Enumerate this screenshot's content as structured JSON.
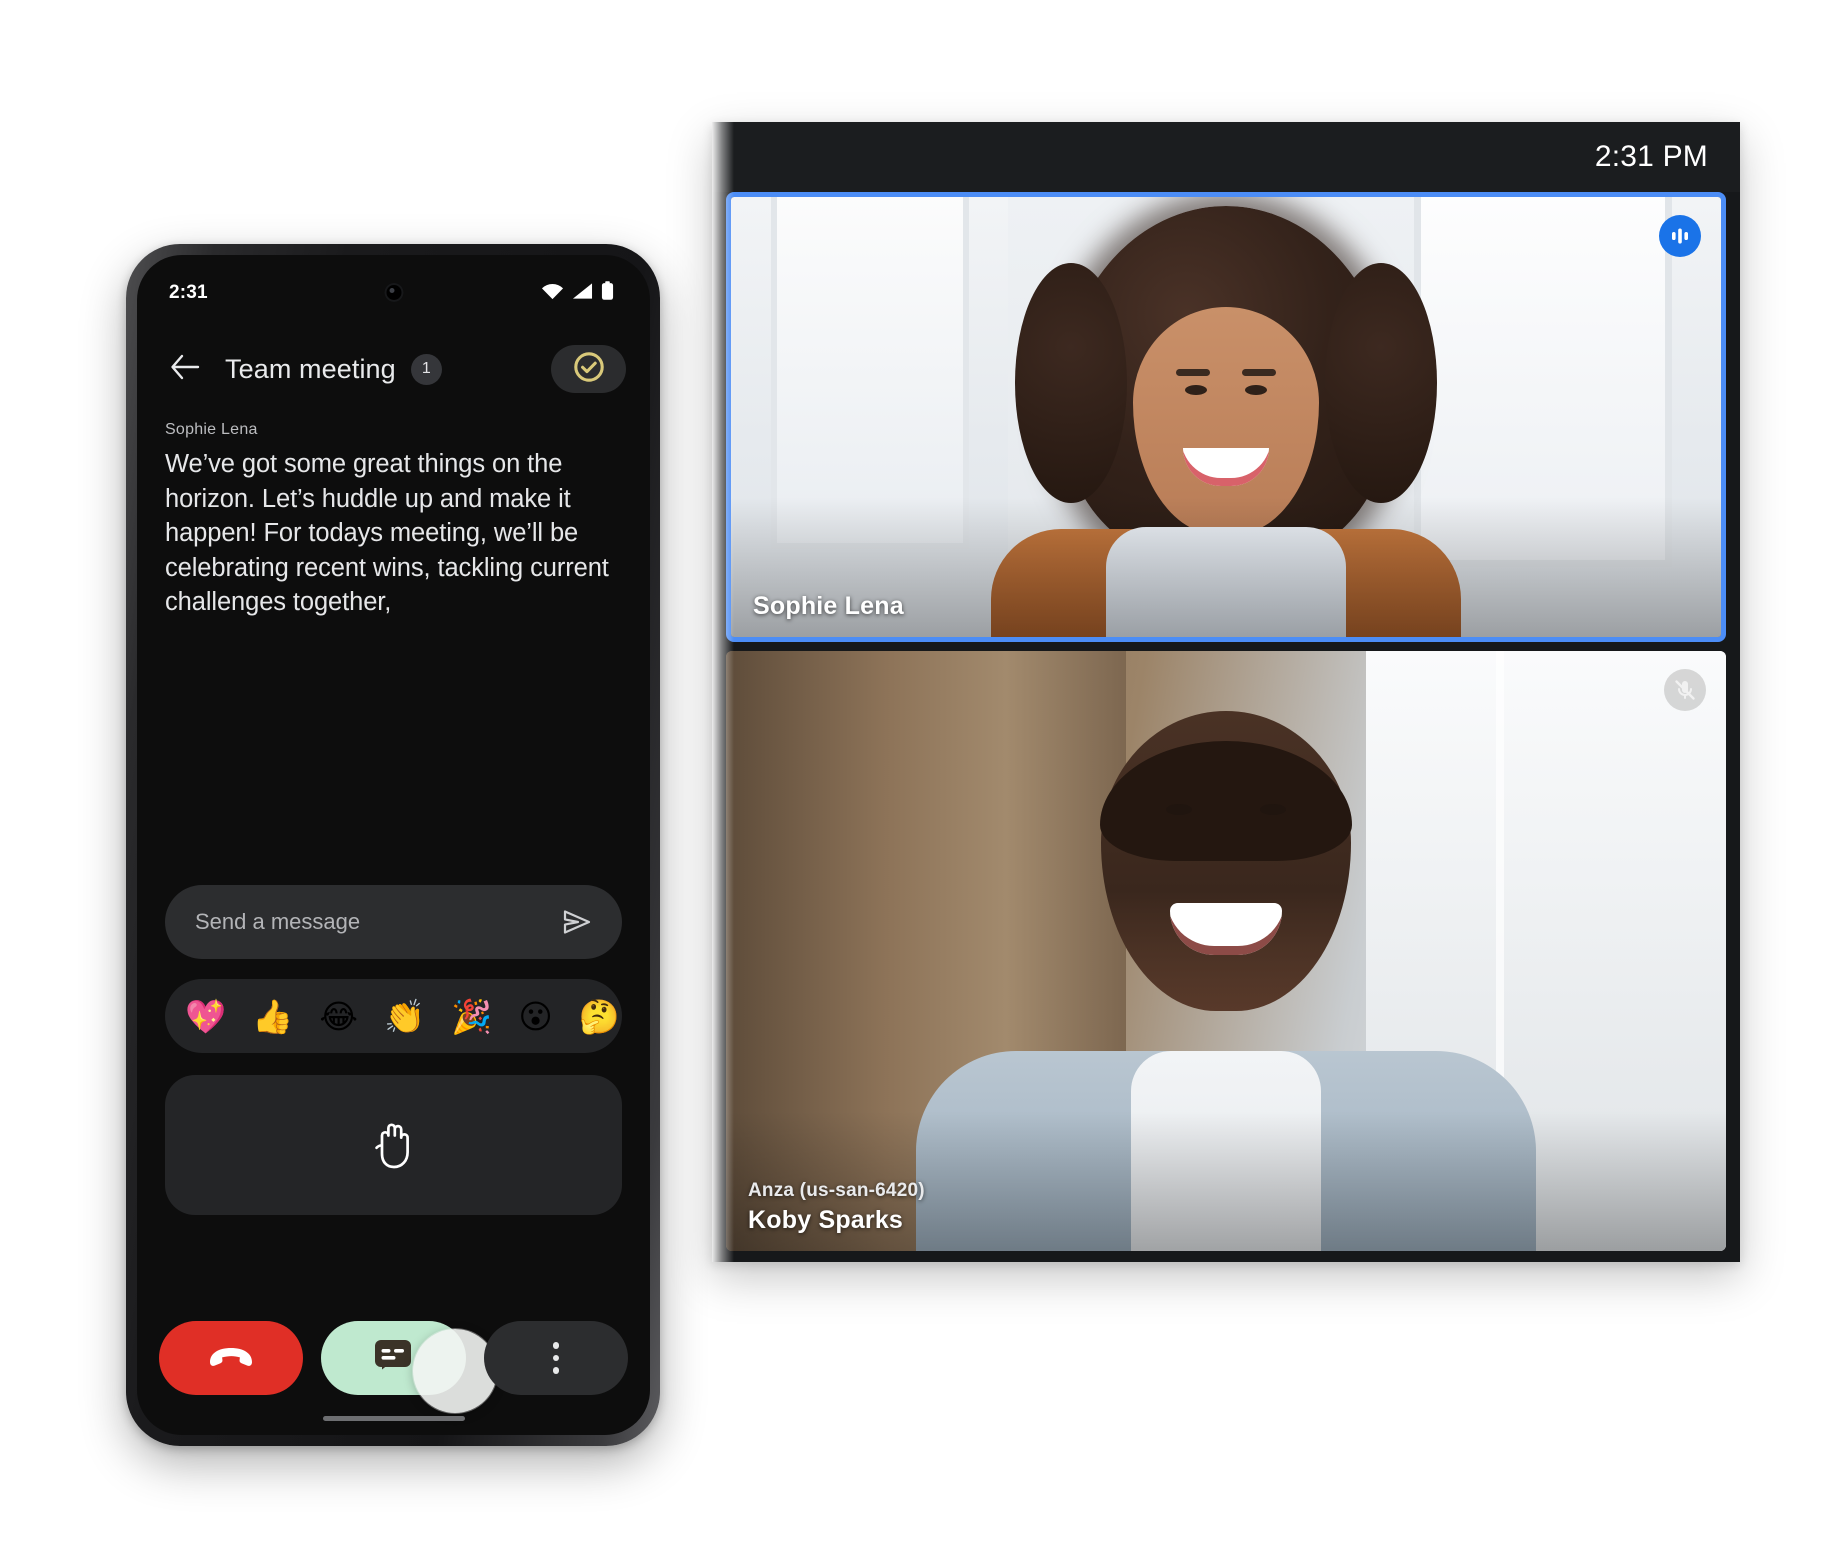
{
  "phone": {
    "statusbar": {
      "time": "2:31",
      "icons": [
        "wifi-icon",
        "cellular-signal-icon",
        "battery-icon"
      ]
    },
    "appbar": {
      "back_icon": "back-arrow-icon",
      "title": "Team meeting",
      "count": "1",
      "action_icon": "check-circle-icon",
      "action_color": "#d9c97a"
    },
    "message": {
      "sender": "Sophie Lena",
      "body": "We’ve got some great things on the horizon. Let’s huddle up and make it happen! For todays meeting, we’ll be celebrating recent wins, tackling current challenges together,"
    },
    "composer": {
      "placeholder": "Send a message",
      "value": "",
      "send_icon": "send-icon"
    },
    "reactions": [
      {
        "name": "sparkling-heart-emoji",
        "glyph": "💖"
      },
      {
        "name": "thumbs-up-emoji",
        "glyph": "👍"
      },
      {
        "name": "face-with-tears-of-joy-emoji",
        "glyph": "😂"
      },
      {
        "name": "clapping-hands-emoji",
        "glyph": "👏"
      },
      {
        "name": "party-popper-emoji",
        "glyph": "🎉"
      },
      {
        "name": "face-with-open-mouth-emoji",
        "glyph": "😮"
      },
      {
        "name": "thinking-face-emoji",
        "glyph": "🤔"
      }
    ],
    "raise_hand": {
      "icon": "raise-hand-icon"
    },
    "controls": [
      {
        "name": "end-call-button",
        "icon": "end-call-icon",
        "color": "#e02f26"
      },
      {
        "name": "chat-button",
        "icon": "chat-icon",
        "color": "#bfe9cf"
      },
      {
        "name": "more-options-button",
        "icon": "more-vertical-icon",
        "color": "#2c2d2f"
      }
    ],
    "touch_indicator": "touch-press-indicator"
  },
  "video": {
    "topbar": {
      "time": "2:31 PM"
    },
    "tiles": [
      {
        "name": "Sophie Lena",
        "sublabel": "",
        "badge": "active-speaker-icon",
        "badge_state": "speaking",
        "active": true,
        "border_color": "#4c8df6"
      },
      {
        "name": "Koby Sparks",
        "sublabel": "Anza (us-san-6420)",
        "badge": "mic-off-icon",
        "badge_state": "muted",
        "active": false,
        "border_color": ""
      }
    ]
  }
}
